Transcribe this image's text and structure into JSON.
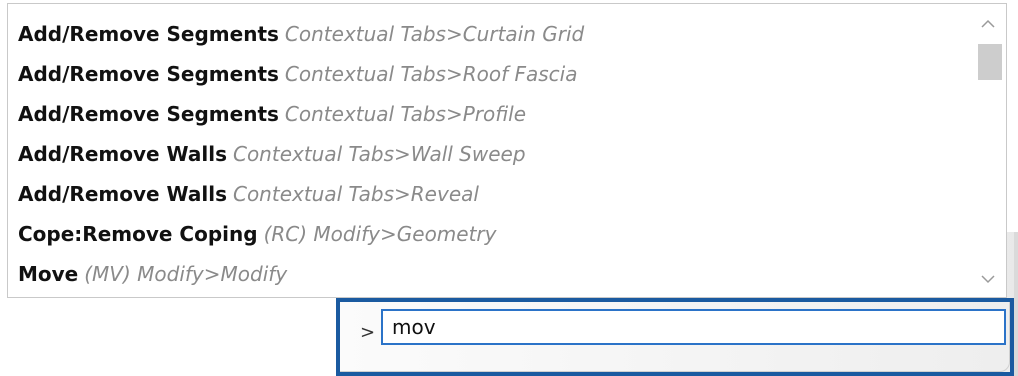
{
  "suggestions": {
    "items": [
      {
        "command": "Add/Remove Segments",
        "path": "Contextual Tabs>Curtain Grid"
      },
      {
        "command": "Add/Remove Segments",
        "path": "Contextual Tabs>Roof Fascia"
      },
      {
        "command": "Add/Remove Segments",
        "path": "Contextual Tabs>Profile"
      },
      {
        "command": "Add/Remove Walls",
        "path": "Contextual Tabs>Wall Sweep"
      },
      {
        "command": "Add/Remove Walls",
        "path": "Contextual Tabs>Reveal"
      },
      {
        "command": "Cope:Remove Coping",
        "path": "(RC) Modify>Geometry"
      },
      {
        "command": "Move",
        "path": "(MV) Modify>Modify"
      }
    ],
    "scroll_up_icon": "chevron-up-icon",
    "scroll_down_icon": "chevron-down-icon"
  },
  "command_bar": {
    "prompt": ">",
    "value": "mov"
  },
  "colors": {
    "focus_border": "#1a5aa0",
    "input_border": "#2b73c8",
    "secondary_text": "#8a8a8a"
  }
}
